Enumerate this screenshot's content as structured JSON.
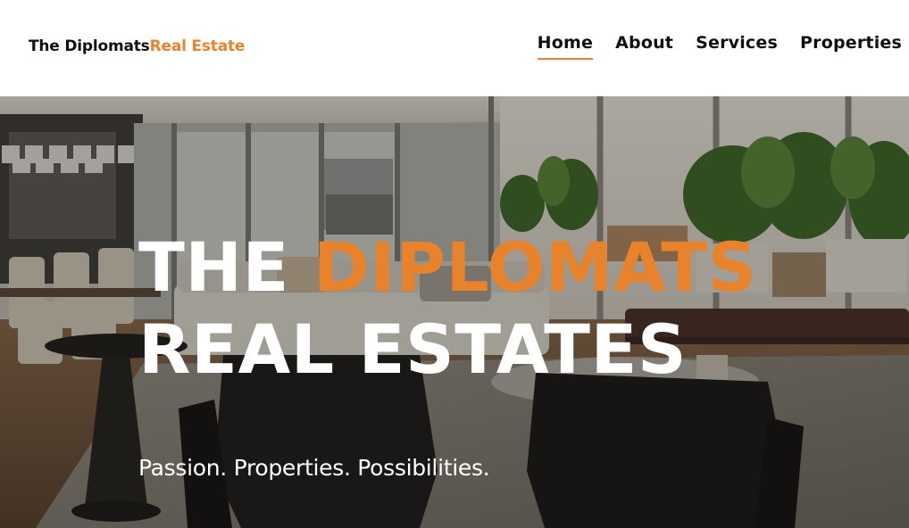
{
  "header": {
    "brand_part1": "The Diplomats",
    "brand_part2": "Real Estate",
    "nav": [
      "Home",
      "About",
      "Services",
      "Properties"
    ],
    "active_nav": "Home"
  },
  "hero": {
    "title_word1": "THE",
    "title_word2": "DIPLOMATS",
    "title_line2": "REAL ESTATES",
    "subtitle": "Passion. Properties. Possibilities."
  },
  "colors": {
    "accent": "#e8822b",
    "text_dark": "#111111",
    "text_light": "#ffffff"
  }
}
